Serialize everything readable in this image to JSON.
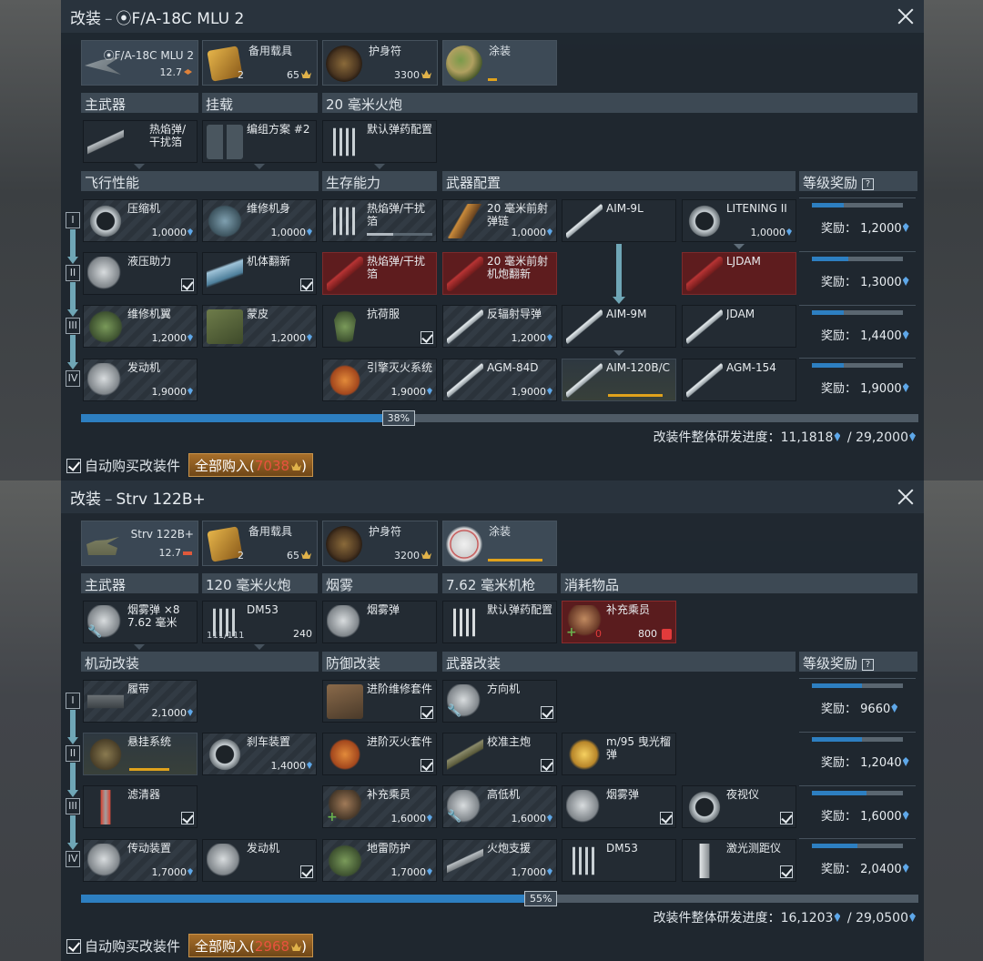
{
  "panels": [
    {
      "title_prefix": "改装",
      "vehicle_title": "⦿F/A-18C MLU 2",
      "vehicle_card": {
        "name": "⦿F/A-18C MLU 2",
        "br": "12.7"
      },
      "backup": {
        "label": "备用载具",
        "count": "2",
        "price": "65"
      },
      "talisman": {
        "label": "护身符",
        "price": "3300"
      },
      "camo": {
        "label": "涂装"
      },
      "weapon_sections": [
        "主武器",
        "挂载",
        "20 毫米火炮"
      ],
      "weapon_cards": [
        {
          "name": "热焰弹/干扰箔 ×120 20 ..."
        },
        {
          "name": "编组方案 #2"
        },
        {
          "name": "默认弹药配置"
        }
      ],
      "mod_sections": [
        "飞行性能",
        "生存能力",
        "武器配置",
        "等级奖励"
      ],
      "tiers": [
        "I",
        "II",
        "III",
        "IV"
      ],
      "mods": {
        "c1": [
          {
            "name": "压缩机",
            "cost": "1,0000"
          },
          {
            "name": "液压助力",
            "cost": ""
          },
          {
            "name": "维修机翼",
            "cost": "1,2000"
          },
          {
            "name": "发动机",
            "cost": "1,9000"
          }
        ],
        "c2": [
          {
            "name": "维修机身",
            "cost": "1,0000"
          },
          {
            "name": "机体翻新",
            "cost": ""
          },
          {
            "name": "蒙皮",
            "cost": "1,2000"
          }
        ],
        "c3": [
          {
            "name": "热焰弹/干扰箔",
            "cost": ""
          },
          {
            "name": "热焰弹/干扰箔",
            "cost": ""
          },
          {
            "name": "抗荷服",
            "cost": ""
          },
          {
            "name": "引擎灭火系统",
            "cost": "1,9000"
          }
        ],
        "c4": [
          {
            "name": "20 毫米前射弹链",
            "cost": "1,0000"
          },
          {
            "name": "20 毫米前射机炮翻新",
            "cost": ""
          },
          {
            "name": "反辐射导弹",
            "cost": "1,2000"
          },
          {
            "name": "AGM-84D",
            "cost": "1,9000"
          }
        ],
        "c5": [
          {
            "name": "AIM-9L",
            "cost": ""
          },
          {
            "name": "AIM-9M",
            "cost": ""
          },
          {
            "name": "AIM-120B/C",
            "cost": ""
          }
        ],
        "c6": [
          {
            "name": "LITENING II",
            "cost": "1,0000"
          },
          {
            "name": "LJDAM",
            "cost": ""
          },
          {
            "name": "JDAM",
            "cost": ""
          },
          {
            "name": "AGM-154",
            "cost": ""
          }
        ]
      },
      "rewards": [
        {
          "label": "奖励：",
          "value": "1,2000",
          "fill": 0.35
        },
        {
          "label": "奖励：",
          "value": "1,3000",
          "fill": 0.4
        },
        {
          "label": "奖励：",
          "value": "1,4400",
          "fill": 0.35
        },
        {
          "label": "奖励：",
          "value": "1,9000",
          "fill": 0.35
        }
      ],
      "progress": {
        "percent_label": "38%",
        "fraction": 0.38
      },
      "totals": {
        "label": "改装件整体研发进度：",
        "current": "11,1818",
        "sep": "/",
        "total": "29,2000"
      },
      "auto_buy": "自动购买改装件",
      "buy_all": {
        "label": "全部购入",
        "price": "7038"
      }
    },
    {
      "title_prefix": "改装",
      "vehicle_title": "Strv 122B+",
      "vehicle_card": {
        "name": "Strv 122B+",
        "br": "12.7"
      },
      "backup": {
        "label": "备用载具",
        "count": "2",
        "price": "65"
      },
      "talisman": {
        "label": "护身符",
        "price": "3200"
      },
      "camo": {
        "label": "涂装"
      },
      "weapon_sections": [
        "主武器",
        "120 毫米火炮",
        "烟雾",
        "7.62 毫米机枪",
        "消耗物品"
      ],
      "weapon_cards": [
        {
          "name": "烟雾弹 ×8 7.62 毫米 94 ..."
        },
        {
          "name": "DM53",
          "count": "240",
          "ammo": "111/111"
        },
        {
          "name": "烟雾弹"
        },
        {
          "name": "默认弹药配置"
        },
        {
          "name": "补充乘员",
          "count": "0",
          "price": "800"
        }
      ],
      "mod_sections": [
        "机动改装",
        "防御改装",
        "武器改装",
        "等级奖励"
      ],
      "tiers": [
        "I",
        "II",
        "III",
        "IV"
      ],
      "mods": {
        "c1": [
          {
            "name": "履带",
            "cost": "2,1000"
          },
          {
            "name": "悬挂系统",
            "cost": ""
          },
          {
            "name": "滤清器",
            "cost": ""
          },
          {
            "name": "传动装置",
            "cost": "1,7000"
          }
        ],
        "c2": [
          {
            "name": "刹车装置",
            "cost": "1,4000"
          },
          {
            "name": "发动机",
            "cost": ""
          }
        ],
        "c3": [
          {
            "name": "进阶维修套件",
            "cost": ""
          },
          {
            "name": "进阶灭火套件",
            "cost": ""
          },
          {
            "name": "补充乘员",
            "cost": "1,6000"
          },
          {
            "name": "地雷防护",
            "cost": "1,7000"
          }
        ],
        "c4": [
          {
            "name": "方向机",
            "cost": ""
          },
          {
            "name": "校准主炮",
            "cost": ""
          },
          {
            "name": "高低机",
            "cost": "1,6000"
          },
          {
            "name": "火炮支援",
            "cost": "1,7000"
          }
        ],
        "c5": [
          {
            "name": "m/95 曳光榴弹",
            "cost": ""
          },
          {
            "name": "烟雾弹",
            "cost": ""
          },
          {
            "name": "DM53",
            "cost": ""
          }
        ],
        "c6": [
          {
            "name": "夜视仪",
            "cost": ""
          },
          {
            "name": "激光测距仪",
            "cost": ""
          }
        ]
      },
      "rewards": [
        {
          "label": "奖励：",
          "value": "9660",
          "fill": 0.55
        },
        {
          "label": "奖励：",
          "value": "1,2040",
          "fill": 0.55
        },
        {
          "label": "奖励：",
          "value": "1,6000",
          "fill": 0.6
        },
        {
          "label": "奖励：",
          "value": "2,0400",
          "fill": 0.5
        }
      ],
      "progress": {
        "percent_label": "55%",
        "fraction": 0.55
      },
      "totals": {
        "label": "改装件整体研发进度：",
        "current": "16,1203",
        "sep": "/",
        "total": "29,0500"
      },
      "auto_buy": "自动购买改装件",
      "buy_all": {
        "label": "全部购入",
        "price": "2968"
      }
    }
  ],
  "colors": {
    "accent_blue": "#2d7fc1",
    "gold": "#e0b24a",
    "red_locked": "#5e1c1e",
    "buy_button": "#a86f2a"
  }
}
